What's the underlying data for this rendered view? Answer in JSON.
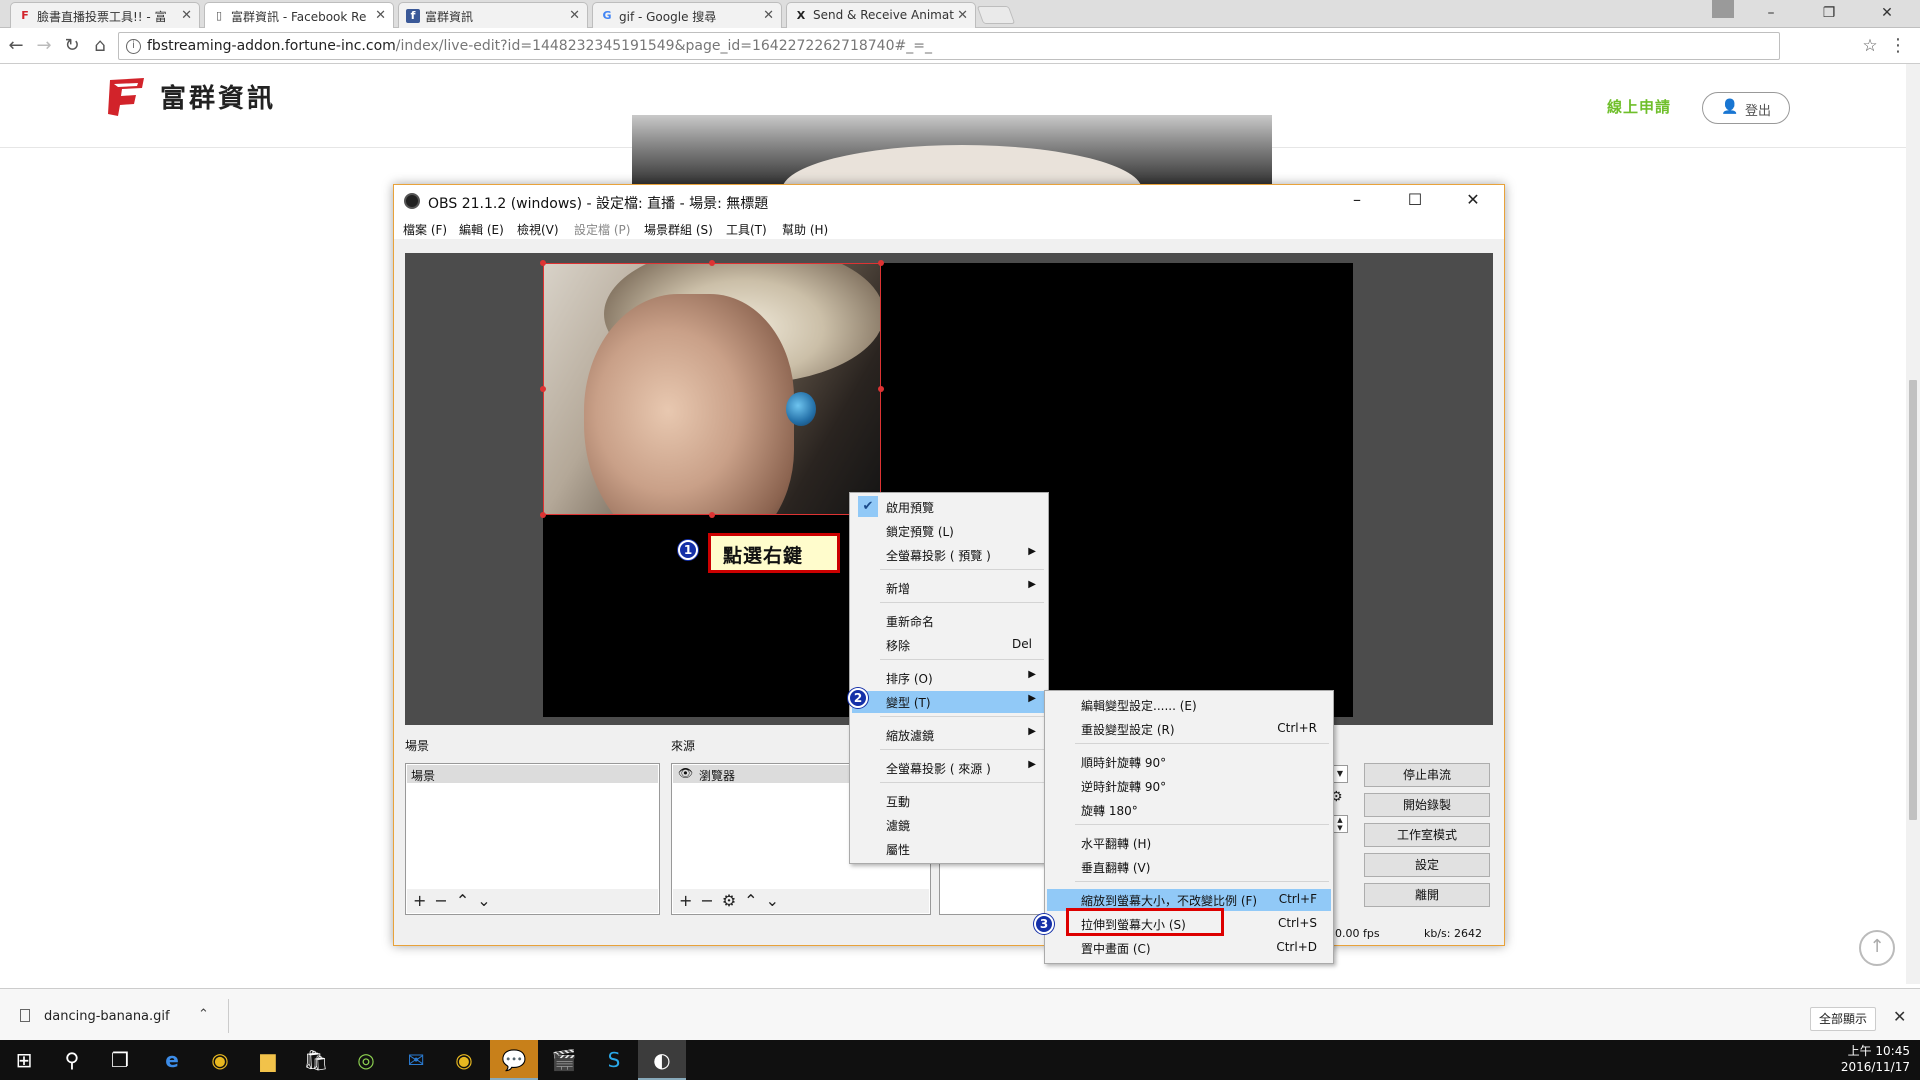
{
  "browser": {
    "tabs": [
      {
        "label": "臉書直播投票工具!! - 富",
        "icon": "fortune-logo-icon"
      },
      {
        "label": "富群資訊 - Facebook Re",
        "icon": "page-icon"
      },
      {
        "label": "富群資訊",
        "icon": "facebook-icon"
      },
      {
        "label": "gif - Google 搜尋",
        "icon": "google-icon"
      },
      {
        "label": "Send & Receive Animat",
        "icon": "x-logo-icon"
      }
    ],
    "url_host": "fbstreaming-addon.fortune-inc.com",
    "url_path": "/index/live-edit?id=1448232345191549&page_id=1642272262718740#_=_"
  },
  "site": {
    "brand": "富群資訊",
    "apply_link": "線上申請",
    "logout": "登出"
  },
  "obs": {
    "title": "OBS 21.1.2 (windows) - 設定檔: 直播 - 場景: 無標題",
    "menu": [
      "檔案 (F)",
      "編輯 (E)",
      "檢視(V)",
      "設定檔 (P)",
      "場景群組 (S)",
      "工具(T)",
      "幫助 (H)"
    ],
    "scenes_label": "場景",
    "scenes_item": "場景",
    "sources_label": "來源",
    "sources_item": "瀏覽器",
    "controls": [
      "停止串流",
      "開始錄製",
      "工作室模式",
      "設定",
      "離開"
    ],
    "status_fps": "30.00 fps",
    "status_kbs": "kb/s: 2642"
  },
  "annotations": {
    "step1": "1",
    "step2": "2",
    "step3": "3",
    "callout": "點選右鍵"
  },
  "context_menu": {
    "items": [
      {
        "label": "啟用預覽",
        "checked": true
      },
      {
        "label": "鎖定預覽 (L)"
      },
      {
        "label": "全螢幕投影 ( 預覽 )",
        "submenu": true
      },
      {
        "label": "新增",
        "submenu": true
      },
      {
        "label": "重新命名"
      },
      {
        "label": "移除",
        "shortcut": "Del"
      },
      {
        "label": "排序 (O)",
        "submenu": true
      },
      {
        "label": "變型 (T)",
        "submenu": true,
        "highlighted": true
      },
      {
        "label": "縮放濾鏡",
        "submenu": true
      },
      {
        "label": "全螢幕投影 ( 來源 )",
        "submenu": true
      },
      {
        "label": "互動"
      },
      {
        "label": "濾鏡"
      },
      {
        "label": "屬性"
      }
    ]
  },
  "transform_menu": {
    "items": [
      {
        "label": "編輯變型設定...... (E)",
        "shortcut": ""
      },
      {
        "label": "重設變型設定 (R)",
        "shortcut": "Ctrl+R"
      },
      {
        "label": "順時針旋轉 90°",
        "shortcut": ""
      },
      {
        "label": "逆時針旋轉 90°",
        "shortcut": ""
      },
      {
        "label": "旋轉 180°",
        "shortcut": ""
      },
      {
        "label": "水平翻轉 (H)",
        "shortcut": ""
      },
      {
        "label": "垂直翻轉 (V)",
        "shortcut": ""
      },
      {
        "label": "縮放到螢幕大小，不改變比例 (F)",
        "shortcut": "Ctrl+F"
      },
      {
        "label": "拉伸到螢幕大小 (S)",
        "shortcut": "Ctrl+S"
      },
      {
        "label": "置中畫面 (C)",
        "shortcut": "Ctrl+D"
      }
    ]
  },
  "downloads": {
    "file": "dancing-banana.gif",
    "show_all": "全部顯示"
  },
  "clock": {
    "time": "上午 10:45",
    "date": "2016/11/17"
  }
}
